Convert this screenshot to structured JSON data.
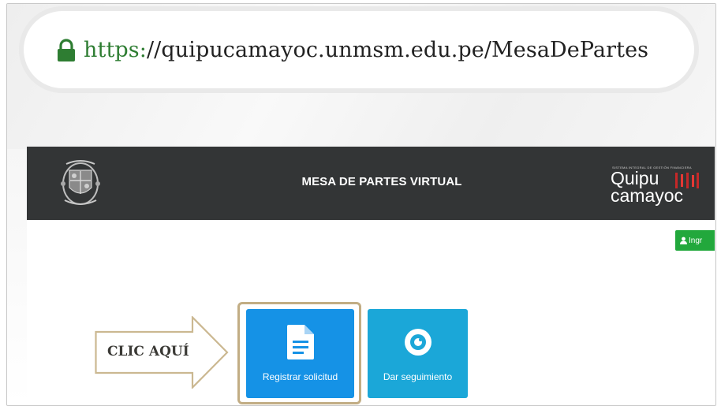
{
  "browser": {
    "url_scheme": "https:",
    "url_rest": "//quipucamayoc.unmsm.edu.pe/MesaDePartes"
  },
  "header": {
    "title": "MESA DE PARTES VIRTUAL"
  },
  "brand": {
    "tagline": "SISTEMA INTEGRAL DE GESTIÓN FINANCIERA",
    "line1": "Quipu",
    "line2": "camayoc"
  },
  "login": {
    "label": "Ingr"
  },
  "callout": {
    "label": "CLIC AQUÍ"
  },
  "tiles": [
    {
      "label": "Registrar solicitud",
      "icon": "document-icon"
    },
    {
      "label": "Dar seguimiento",
      "icon": "eye-icon"
    }
  ],
  "colors": {
    "header_bg": "#333536",
    "url_scheme": "#2e7d32",
    "login_green": "#22a83c",
    "tile_register": "#1592e6",
    "tile_track": "#1ba7d8",
    "highlight_border": "#c2ad84"
  }
}
